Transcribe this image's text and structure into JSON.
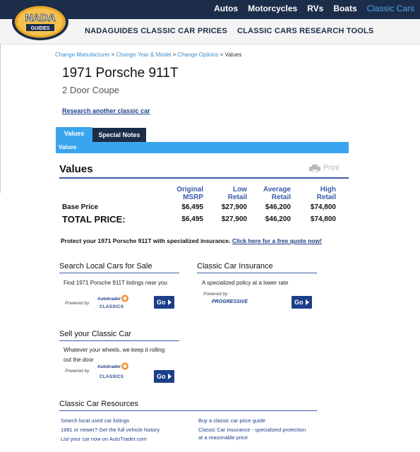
{
  "logo": {
    "line1": "NADA",
    "line2": "GUIDES"
  },
  "top_nav": [
    "Autos",
    "Motorcycles",
    "RVs",
    "Boats",
    "Classic Cars"
  ],
  "sub_nav": [
    "NADAGUIDES CLASSIC CAR PRICES",
    "CLASSIC CARS RESEARCH TOOLS"
  ],
  "breadcrumb": {
    "items": [
      "Change Manufacturer",
      "Change Year & Model",
      "Change Options"
    ],
    "current": "Values",
    "sep": ">"
  },
  "car": {
    "title": "1971 Porsche 911T",
    "subtitle": "2 Door Coupe"
  },
  "research_link": "Research another classic car",
  "tabs": {
    "values": "Values",
    "notes": "Special Notes",
    "bar_label": "Values"
  },
  "values": {
    "heading": "Values",
    "print_label": "Print",
    "columns": [
      {
        "line1": "Original",
        "line2": "MSRP"
      },
      {
        "line1": "Low",
        "line2": "Retail"
      },
      {
        "line1": "Average",
        "line2": "Retail"
      },
      {
        "line1": "High",
        "line2": "Retail"
      }
    ],
    "rows": [
      {
        "label": "Base Price",
        "cells": [
          "$6,495",
          "$27,900",
          "$46,200",
          "$74,800"
        ]
      },
      {
        "label": "TOTAL PRICE:",
        "cells": [
          "$6,495",
          "$27,900",
          "$46,200",
          "$74,800"
        ]
      }
    ]
  },
  "protect": {
    "text": "Protect your 1971 Porsche 911T with specialized insurance.",
    "link": "Click here for a free quote now!"
  },
  "local_cars": {
    "title": "Search Local Cars for Sale",
    "text": "Find 1971 Porsche 911T listings near you",
    "powered": "Powered by",
    "brand1": "Autotrader",
    "brand2": "CLASSICS",
    "go": "Go"
  },
  "insurance": {
    "title": "Classic Car Insurance",
    "text": "A specialized policy at a lower rate",
    "powered": "Powered by",
    "brand": "PROGRESSIVE",
    "go": "Go"
  },
  "sell": {
    "title": "Sell your Classic Car",
    "text_line1": "Whatever your wheels, we keep it rolling",
    "text_line2": "out the door",
    "powered": "Powered by",
    "brand1": "Autotrader",
    "brand2": "CLASSICS",
    "go": "Go"
  },
  "resources": {
    "title": "Classic Car Resources",
    "left": [
      "Search local used car listings",
      "1981 or newer? Get the full vehicle history",
      "List your car now on AutoTrader.com"
    ],
    "right": [
      "Buy a classic car price guide",
      "Classic Car Insurance - specialized protection",
      "at a reasonable price"
    ]
  },
  "colors": {
    "navy": "#1c2d4a",
    "blue": "#3aa5ee",
    "link": "#1c3f8a",
    "gold": "#e9a826"
  }
}
